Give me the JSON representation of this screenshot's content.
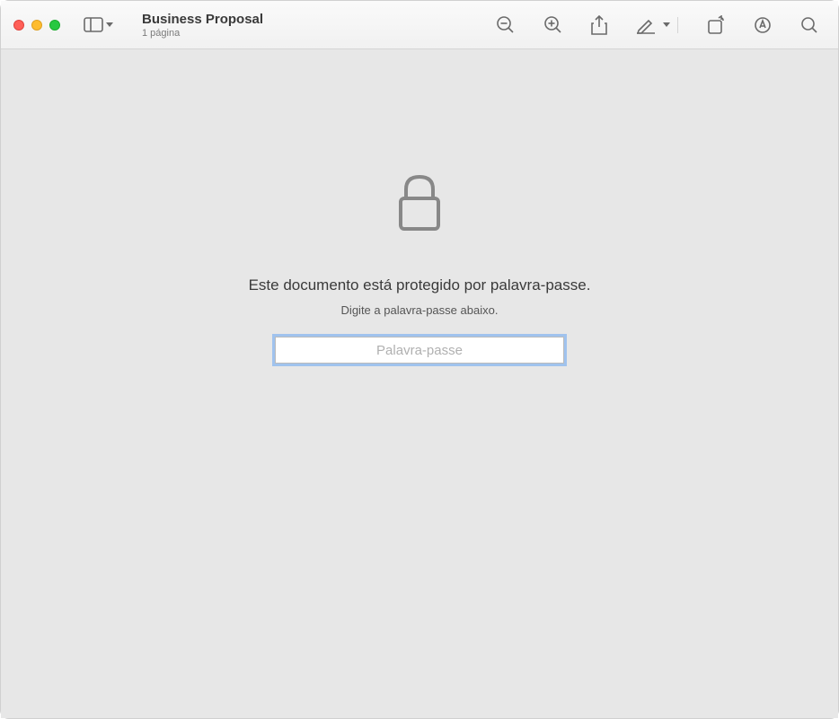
{
  "header": {
    "title": "Business Proposal",
    "subtitle": "1 página"
  },
  "content": {
    "protected_message": "Este documento está protegido por palavra-passe.",
    "instruction": "Digite a palavra-passe abaixo.",
    "password_placeholder": "Palavra-passe"
  }
}
